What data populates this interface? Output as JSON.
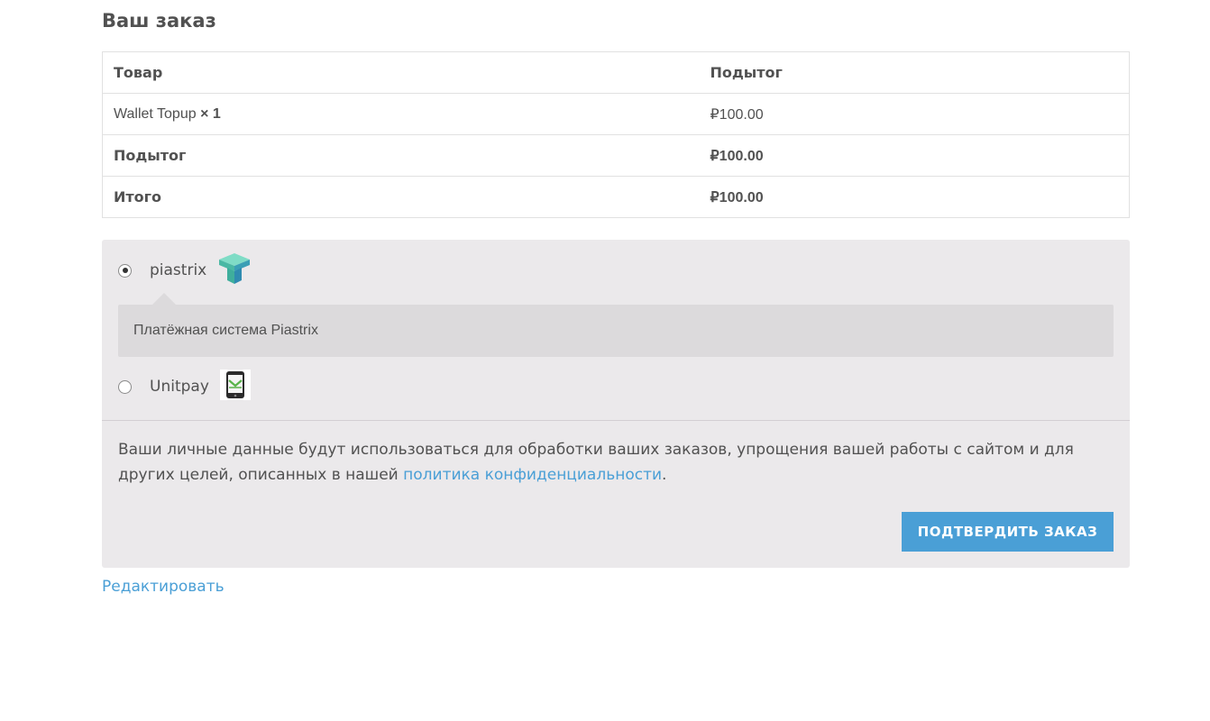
{
  "page_title": "Ваш заказ",
  "order_table": {
    "headers": {
      "product": "Товар",
      "subtotal": "Подытог"
    },
    "item": {
      "name": "Wallet Topup",
      "qty": "× 1",
      "price": "₽100.00"
    },
    "subtotal_row": {
      "label": "Подытог",
      "value": "₽100.00"
    },
    "total_row": {
      "label": "Итого",
      "value": "₽100.00"
    }
  },
  "payment": {
    "methods": [
      {
        "label": "piastrix",
        "icon": "piastrix-logo-icon",
        "selected": true,
        "description": "Платёжная система Piastrix"
      },
      {
        "label": "Unitpay",
        "icon": "unitpay-phone-icon",
        "selected": false
      }
    ],
    "privacy_text": "Ваши личные данные будут использоваться для обработки ваших заказов, упрощения вашей работы с сайтом и для других целей, описанных в нашей ",
    "privacy_link": "политика конфиденциальности",
    "privacy_end": ".",
    "place_order_label": "ПОДТВЕРДИТЬ ЗАКАЗ"
  },
  "edit_link": "Редактировать",
  "colors": {
    "accent": "#4a9fd6",
    "panel": "#ebe9eb",
    "text": "#515151"
  }
}
